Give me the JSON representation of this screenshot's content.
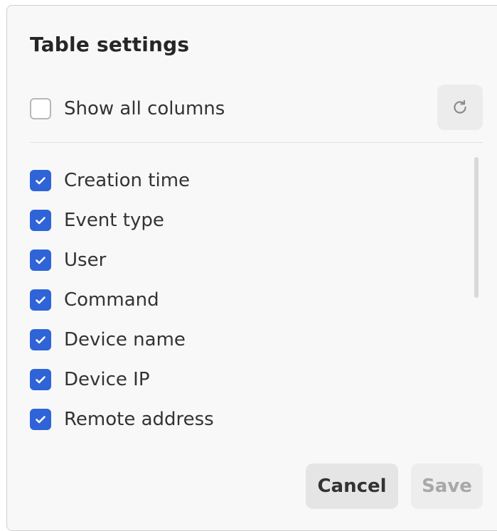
{
  "dialog": {
    "title": "Table settings"
  },
  "show_all": {
    "label": "Show all columns",
    "checked": false
  },
  "reset_button": {
    "icon": "refresh-icon"
  },
  "columns": [
    {
      "label": "Creation time",
      "checked": true
    },
    {
      "label": "Event type",
      "checked": true
    },
    {
      "label": "User",
      "checked": true
    },
    {
      "label": "Command",
      "checked": true
    },
    {
      "label": "Device name",
      "checked": true
    },
    {
      "label": "Device IP",
      "checked": true
    },
    {
      "label": "Remote address",
      "checked": true
    }
  ],
  "footer": {
    "cancel_label": "Cancel",
    "save_label": "Save",
    "save_disabled": true
  },
  "colors": {
    "checkbox_checked": "#2f63d8",
    "dialog_background": "#f8f8f8"
  }
}
